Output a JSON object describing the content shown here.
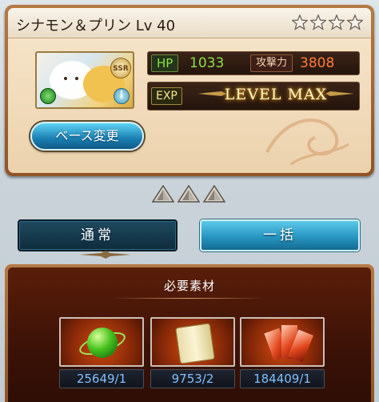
{
  "card": {
    "title": "シナモン＆プリン Lv 40",
    "stars": 4,
    "rarity_badge": "SSR",
    "info_glyph": "i",
    "hp_label": "HP",
    "hp_value": "1033",
    "atk_label": "攻撃力",
    "atk_value": "3808",
    "exp_label": "EXP",
    "exp_status": "LEVEL MAX",
    "base_change_button": "ベース変更"
  },
  "tabs": {
    "normal": "通常",
    "bulk": "一括"
  },
  "materials": {
    "title": "必要素材",
    "items": [
      {
        "icon": "green-orb-icon",
        "count": "25649/1"
      },
      {
        "icon": "scroll-icon",
        "count": "9753/2"
      },
      {
        "icon": "red-crystal-icon",
        "count": "184409/1"
      }
    ]
  },
  "colors": {
    "hp_value": "#8ee046",
    "atk_value": "#ff7a3a",
    "accent_blue": "#2796c2",
    "frame_bronze": "#a56a36"
  }
}
